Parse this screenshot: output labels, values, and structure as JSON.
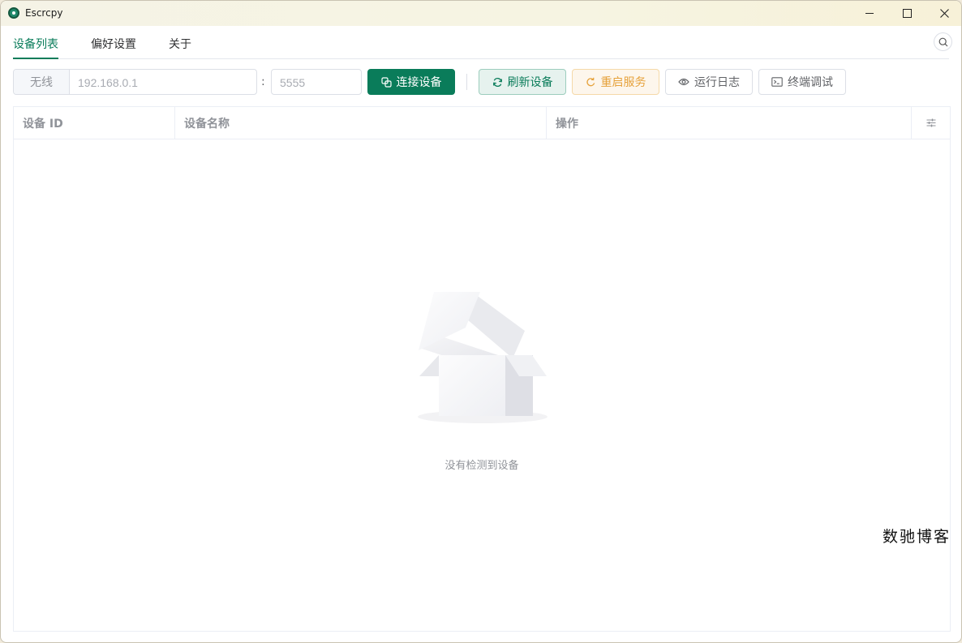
{
  "window": {
    "title": "Escrcpy",
    "controls": {
      "minimize": "minimize-icon",
      "maximize": "maximize-icon",
      "close": "close-icon"
    }
  },
  "tabs": [
    {
      "label": "设备列表",
      "active": true
    },
    {
      "label": "偏好设置",
      "active": false
    },
    {
      "label": "关于",
      "active": false
    }
  ],
  "toolbar": {
    "wireless_label": "无线",
    "ip_placeholder": "192.168.0.1",
    "separator": ":",
    "port_placeholder": "5555",
    "connect_label": "连接设备",
    "refresh_label": "刷新设备",
    "restart_label": "重启服务",
    "log_label": "运行日志",
    "terminal_label": "终端调试"
  },
  "table": {
    "columns": [
      "设备 ID",
      "设备名称",
      "操作"
    ],
    "empty_text": "没有检测到设备"
  },
  "watermark": "数驰博客",
  "colors": {
    "primary": "#0a7c5a",
    "warning": "#e6a23c",
    "border": "#dcdfe6",
    "muted_text": "#909399"
  }
}
